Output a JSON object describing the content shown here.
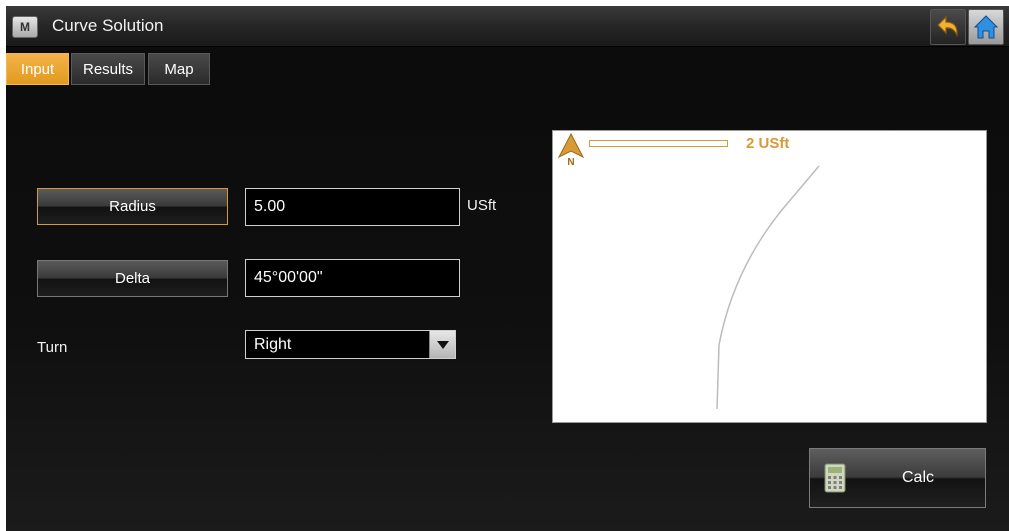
{
  "window": {
    "title": "Curve Solution",
    "app_icon_letter": "M"
  },
  "tabs": [
    {
      "label": "Input",
      "active": true
    },
    {
      "label": "Results",
      "active": false
    },
    {
      "label": "Map",
      "active": false
    }
  ],
  "form": {
    "radius": {
      "button_label": "Radius",
      "value": "5.00",
      "unit": "USft"
    },
    "delta": {
      "button_label": "Delta",
      "value": "45°00'00\""
    },
    "turn": {
      "label": "Turn",
      "selected": "Right"
    }
  },
  "preview": {
    "scale_label": "2 USft",
    "north_label": "N"
  },
  "actions": {
    "calc_label": "Calc"
  },
  "icons": {
    "app": "m-logo-icon",
    "back": "back-arrow-icon",
    "home": "home-icon",
    "dropdown": "chevron-down-icon",
    "north": "north-arrow-icon",
    "calc": "calculator-icon"
  },
  "colors": {
    "accent": "#E29A1F",
    "background": "#0F0F0F",
    "preview_bg": "#FFFFFF"
  }
}
